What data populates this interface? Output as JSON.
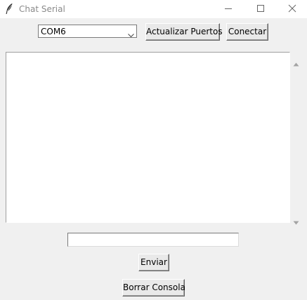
{
  "window": {
    "title": "Chat Serial",
    "icon": "feather-icon"
  },
  "titlebar_buttons": {
    "minimize_icon": "minimize-icon",
    "maximize_icon": "maximize-icon",
    "close_icon": "close-icon"
  },
  "port_selector": {
    "selected": "COM6",
    "icon": "chevron-down-icon"
  },
  "buttons": {
    "refresh_ports": "Actualizar Puertos",
    "connect": "Conectar",
    "send": "Enviar",
    "clear_console": "Borrar Consola"
  },
  "console": {
    "text": ""
  },
  "message_input": {
    "value": "",
    "placeholder": ""
  },
  "colors": {
    "window_background": "#f0f0f0",
    "console_background": "#ffffff",
    "title_text": "#8a8a8a"
  }
}
